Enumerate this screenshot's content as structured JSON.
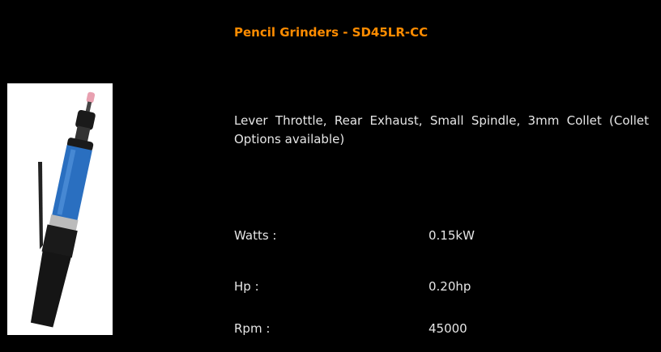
{
  "product": {
    "title": "Pencil Grinders - SD45LR-CC",
    "description": "Lever Throttle, Rear Exhaust, Small Spindle, 3mm Collet (Collet Options available)",
    "specs": [
      {
        "label": "Watts :",
        "value": "0.15kW"
      },
      {
        "label": "Hp :",
        "value": "0.20hp"
      },
      {
        "label": "Rpm :",
        "value": "45000"
      }
    ]
  },
  "colors": {
    "title": "#ff8c00",
    "background": "#000000",
    "tool_body": "#2a6fc0"
  }
}
